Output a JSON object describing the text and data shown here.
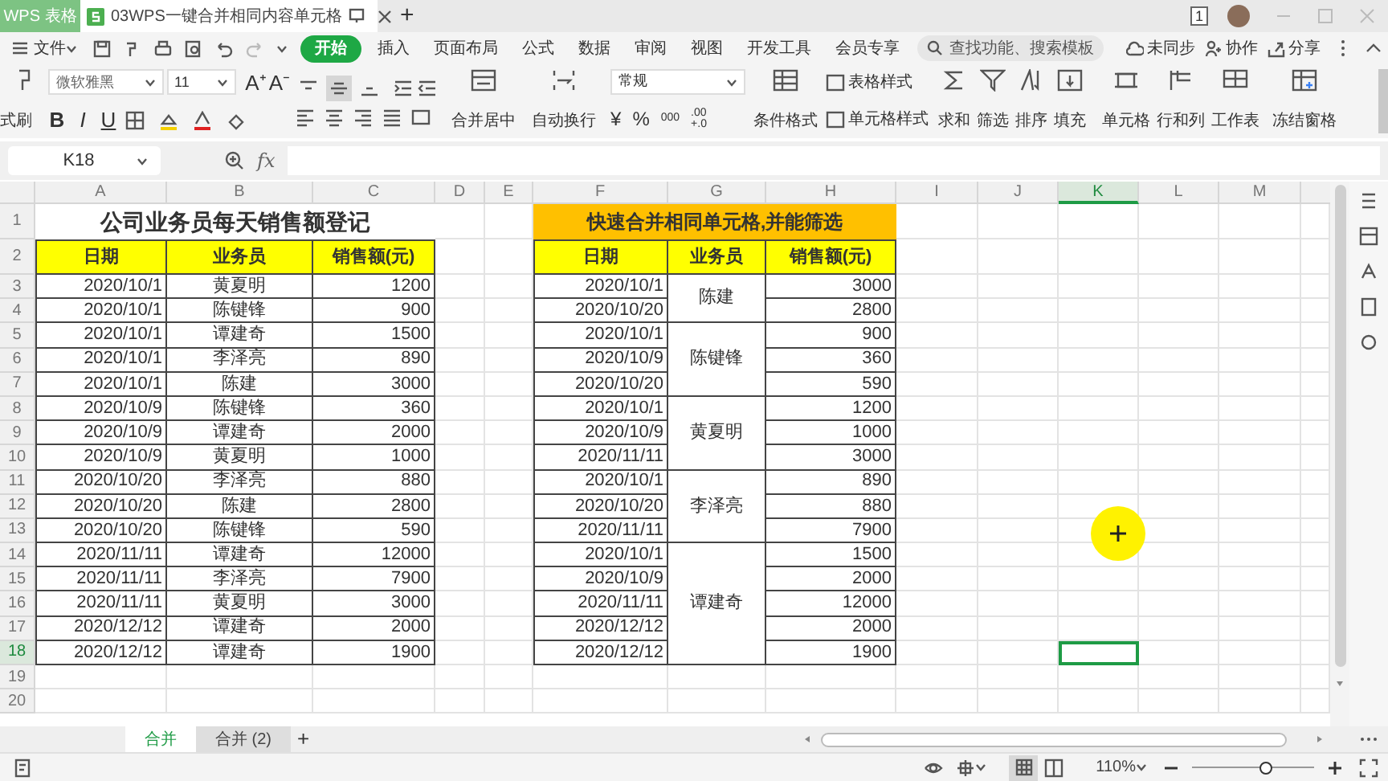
{
  "app_tab": {
    "label": "WPS 表格"
  },
  "document_tab": {
    "title": "03WPS一键合并相同内容单元格"
  },
  "add_tab": "+",
  "window_badge": "1",
  "menu": {
    "file": "文件",
    "tabs": [
      {
        "label": "开始",
        "selected": true
      },
      {
        "label": "插入",
        "selected": false
      },
      {
        "label": "页面布局",
        "selected": false
      },
      {
        "label": "公式",
        "selected": false
      },
      {
        "label": "数据",
        "selected": false
      },
      {
        "label": "审阅",
        "selected": false
      },
      {
        "label": "视图",
        "selected": false
      },
      {
        "label": "开发工具",
        "selected": false
      },
      {
        "label": "会员专享",
        "selected": false
      }
    ],
    "search": {
      "placeholder": "查找功能、搜索模板"
    },
    "actions": [
      "未同步",
      "协作",
      "分享"
    ]
  },
  "ribbon": {
    "format_painter": "式刷",
    "font_name": "微软雅黑",
    "font_size": "11",
    "font_grow": "A⁺",
    "font_shrink": "A⁻",
    "text_styles": [
      "B",
      "I",
      "U"
    ],
    "vertical_align": [
      {
        "selected": false
      },
      {
        "selected": true
      },
      {
        "selected": false
      }
    ],
    "merge": "合并居中",
    "wrap": "自动换行",
    "number_format": "常规",
    "number_buttons": [
      "¥",
      "%",
      "000"
    ],
    "decimal_button": [
      ".00",
      "+.0"
    ],
    "conditional_format": "条件格式",
    "table_styles": [
      "表格样式",
      "单元格样式"
    ],
    "tools": [
      "求和",
      "筛选",
      "排序",
      "填充",
      "单元格",
      "行和列",
      "工作表",
      "冻结窗格"
    ]
  },
  "formula_bar": {
    "name_box": "K18",
    "fx": "fx"
  },
  "columns": [
    {
      "label": "A",
      "selected": false
    },
    {
      "label": "B",
      "selected": false
    },
    {
      "label": "C",
      "selected": false
    },
    {
      "label": "D",
      "selected": false
    },
    {
      "label": "E",
      "selected": false
    },
    {
      "label": "F",
      "selected": false
    },
    {
      "label": "G",
      "selected": false
    },
    {
      "label": "H",
      "selected": false
    },
    {
      "label": "I",
      "selected": false
    },
    {
      "label": "J",
      "selected": false
    },
    {
      "label": "K",
      "selected": true
    },
    {
      "label": "L",
      "selected": false
    },
    {
      "label": "M",
      "selected": false
    }
  ],
  "rows": [
    {
      "label": "1",
      "selected": false
    },
    {
      "label": "2",
      "selected": false
    },
    {
      "label": "3",
      "selected": false
    },
    {
      "label": "4",
      "selected": false
    },
    {
      "label": "5",
      "selected": false
    },
    {
      "label": "6",
      "selected": false
    },
    {
      "label": "7",
      "selected": false
    },
    {
      "label": "8",
      "selected": false
    },
    {
      "label": "9",
      "selected": false
    },
    {
      "label": "10",
      "selected": false
    },
    {
      "label": "11",
      "selected": false
    },
    {
      "label": "12",
      "selected": false
    },
    {
      "label": "13",
      "selected": false
    },
    {
      "label": "14",
      "selected": false
    },
    {
      "label": "15",
      "selected": false
    },
    {
      "label": "16",
      "selected": false
    },
    {
      "label": "17",
      "selected": false
    },
    {
      "label": "18",
      "selected": true
    },
    {
      "label": "19",
      "selected": false
    },
    {
      "label": "20",
      "selected": false
    }
  ],
  "left_table": {
    "title": "公司业务员每天销售额登记",
    "headers": [
      "日期",
      "业务员",
      "销售额(元)"
    ],
    "rows": [
      {
        "date": "2020/10/1",
        "salesperson": "黄夏明",
        "amount": "1200"
      },
      {
        "date": "2020/10/1",
        "salesperson": "陈键锋",
        "amount": "900"
      },
      {
        "date": "2020/10/1",
        "salesperson": "谭建奇",
        "amount": "1500"
      },
      {
        "date": "2020/10/1",
        "salesperson": "李泽亮",
        "amount": "890"
      },
      {
        "date": "2020/10/1",
        "salesperson": "陈建",
        "amount": "3000"
      },
      {
        "date": "2020/10/9",
        "salesperson": "陈键锋",
        "amount": "360"
      },
      {
        "date": "2020/10/9",
        "salesperson": "谭建奇",
        "amount": "2000"
      },
      {
        "date": "2020/10/9",
        "salesperson": "黄夏明",
        "amount": "1000"
      },
      {
        "date": "2020/10/20",
        "salesperson": "李泽亮",
        "amount": "880"
      },
      {
        "date": "2020/10/20",
        "salesperson": "陈建",
        "amount": "2800"
      },
      {
        "date": "2020/10/20",
        "salesperson": "陈键锋",
        "amount": "590"
      },
      {
        "date": "2020/11/11",
        "salesperson": "谭建奇",
        "amount": "12000"
      },
      {
        "date": "2020/11/11",
        "salesperson": "李泽亮",
        "amount": "7900"
      },
      {
        "date": "2020/11/11",
        "salesperson": "黄夏明",
        "amount": "3000"
      },
      {
        "date": "2020/12/12",
        "salesperson": "谭建奇",
        "amount": "2000"
      },
      {
        "date": "2020/12/12",
        "salesperson": "谭建奇",
        "amount": "1900"
      }
    ]
  },
  "right_table": {
    "title": "快速合并相同单元格,并能筛选",
    "headers": [
      "日期",
      "业务员",
      "销售额(元)"
    ],
    "groups": [
      {
        "salesperson": "陈建",
        "rows": [
          {
            "date": "2020/10/1",
            "amount": "3000"
          },
          {
            "date": "2020/10/20",
            "amount": "2800"
          }
        ]
      },
      {
        "salesperson": "陈键锋",
        "rows": [
          {
            "date": "2020/10/1",
            "amount": "900"
          },
          {
            "date": "2020/10/9",
            "amount": "360"
          },
          {
            "date": "2020/10/20",
            "amount": "590"
          }
        ]
      },
      {
        "salesperson": "黄夏明",
        "rows": [
          {
            "date": "2020/10/1",
            "amount": "1200"
          },
          {
            "date": "2020/10/9",
            "amount": "1000"
          },
          {
            "date": "2020/11/11",
            "amount": "3000"
          }
        ]
      },
      {
        "salesperson": "李泽亮",
        "rows": [
          {
            "date": "2020/10/1",
            "amount": "890"
          },
          {
            "date": "2020/10/20",
            "amount": "880"
          },
          {
            "date": "2020/11/11",
            "amount": "7900"
          }
        ]
      },
      {
        "salesperson": "谭建奇",
        "rows": [
          {
            "date": "2020/10/1",
            "amount": "1500"
          },
          {
            "date": "2020/10/9",
            "amount": "2000"
          },
          {
            "date": "2020/11/11",
            "amount": "12000"
          },
          {
            "date": "2020/12/12",
            "amount": "2000"
          },
          {
            "date": "2020/12/12",
            "amount": "1900"
          }
        ]
      }
    ]
  },
  "sheet_tabs": [
    {
      "label": "合并",
      "selected": true
    },
    {
      "label": "合并 (2)",
      "selected": false
    }
  ],
  "add_sheet": "+",
  "status": {
    "zoom": "110%",
    "zoom_slider": {
      "level": 0.6
    }
  }
}
